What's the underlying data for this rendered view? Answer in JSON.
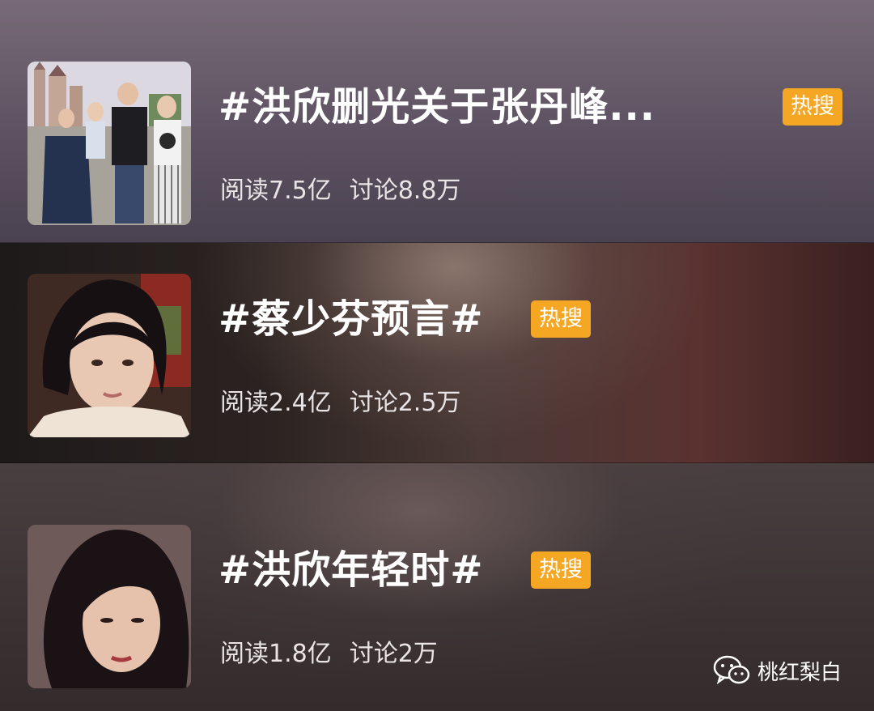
{
  "items": [
    {
      "title": "#洪欣删光关于张丹峰...",
      "badge": "热搜",
      "read_stat": "阅读7.5亿",
      "discuss_stat": "讨论8.8万"
    },
    {
      "title": "#蔡少芬预言#",
      "badge": "热搜",
      "read_stat": "阅读2.4亿",
      "discuss_stat": "讨论2.5万"
    },
    {
      "title": "#洪欣年轻时#",
      "badge": "热搜",
      "read_stat": "阅读1.8亿",
      "discuss_stat": "讨论2万"
    }
  ],
  "watermark": {
    "text": "桃红梨白",
    "icon": "wechat-icon"
  },
  "colors": {
    "badge": "#f5a623",
    "title_text": "#ffffff",
    "stat_text": "#e9e4e6"
  }
}
